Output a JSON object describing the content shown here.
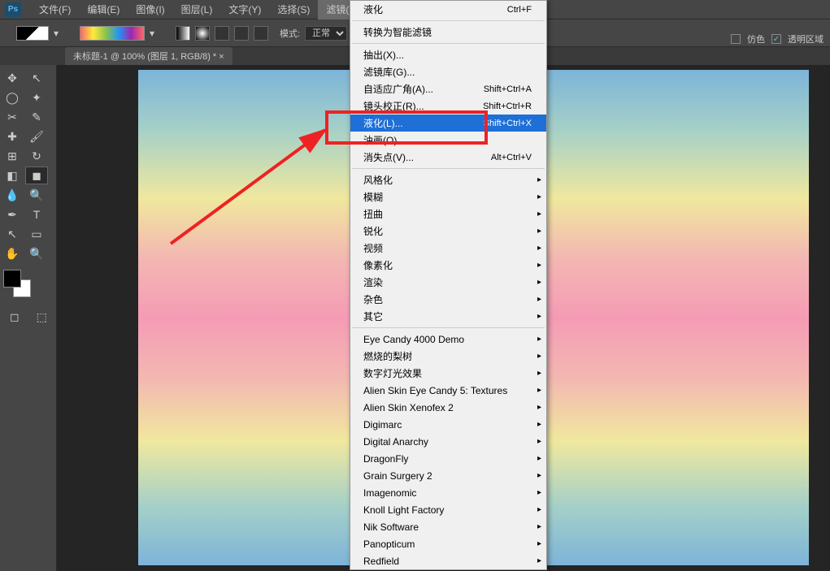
{
  "menubar": {
    "items": [
      {
        "label": "文件(F)"
      },
      {
        "label": "编辑(E)"
      },
      {
        "label": "图像(I)"
      },
      {
        "label": "图层(L)"
      },
      {
        "label": "文字(Y)"
      },
      {
        "label": "选择(S)"
      },
      {
        "label": "滤镜(T)",
        "active": true
      }
    ]
  },
  "optionsBar": {
    "modeLabel": "模式:",
    "modeValue": "正常",
    "rightCheck1": "仿色",
    "rightCheck2": "透明区域"
  },
  "tabstrip": {
    "documentTab": "未标题-1 @ 100% (图层 1, RGB/8) * ×"
  },
  "dropdown": {
    "items": [
      {
        "label": "液化",
        "shortcut": "Ctrl+F"
      },
      {
        "sep": true
      },
      {
        "label": "转换为智能滤镜"
      },
      {
        "sep": true
      },
      {
        "label": "抽出(X)..."
      },
      {
        "label": "滤镜库(G)..."
      },
      {
        "label": "自适应广角(A)...",
        "shortcut": "Shift+Ctrl+A"
      },
      {
        "label": "镜头校正(R)...",
        "shortcut": "Shift+Ctrl+R"
      },
      {
        "label": "液化(L)...",
        "shortcut": "Shift+Ctrl+X",
        "highlight": true
      },
      {
        "label": "油画(O)..."
      },
      {
        "label": "消失点(V)...",
        "shortcut": "Alt+Ctrl+V"
      },
      {
        "sep": true
      },
      {
        "label": "风格化",
        "sub": true
      },
      {
        "label": "模糊",
        "sub": true
      },
      {
        "label": "扭曲",
        "sub": true
      },
      {
        "label": "锐化",
        "sub": true
      },
      {
        "label": "视频",
        "sub": true
      },
      {
        "label": "像素化",
        "sub": true
      },
      {
        "label": "渲染",
        "sub": true
      },
      {
        "label": "杂色",
        "sub": true
      },
      {
        "label": "其它",
        "sub": true
      },
      {
        "sep": true
      },
      {
        "label": "Eye Candy 4000 Demo",
        "sub": true
      },
      {
        "label": "燃烧的梨树",
        "sub": true
      },
      {
        "label": "数字灯光效果",
        "sub": true
      },
      {
        "label": "Alien Skin Eye Candy 5: Textures",
        "sub": true
      },
      {
        "label": "Alien Skin Xenofex 2",
        "sub": true
      },
      {
        "label": "Digimarc",
        "sub": true
      },
      {
        "label": "Digital Anarchy",
        "sub": true
      },
      {
        "label": "DragonFly",
        "sub": true
      },
      {
        "label": "Grain Surgery 2",
        "sub": true
      },
      {
        "label": "Imagenomic",
        "sub": true
      },
      {
        "label": "Knoll Light Factory",
        "sub": true
      },
      {
        "label": "Nik Software",
        "sub": true
      },
      {
        "label": "Panopticum",
        "sub": true
      },
      {
        "label": "Redfield",
        "sub": true
      }
    ]
  },
  "ps": "Ps"
}
